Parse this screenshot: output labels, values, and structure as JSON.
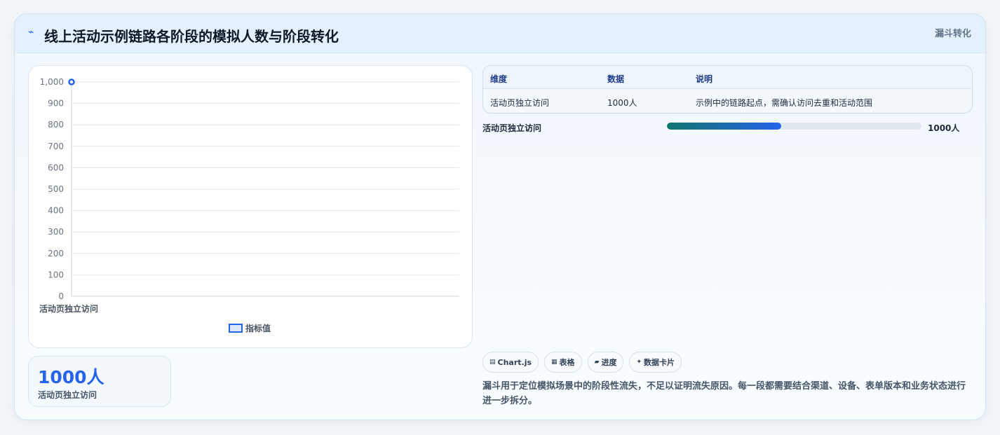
{
  "header": {
    "title": "线上活动示例链路各阶段的模拟人数与阶段转化",
    "tag": "漏斗转化",
    "icon": "trend-line-icon"
  },
  "chart_data": {
    "type": "line",
    "categories": [
      "活动页独立访问"
    ],
    "series": [
      {
        "name": "指标值",
        "values": [
          1000
        ]
      }
    ],
    "y_ticks": [
      "0",
      "100",
      "200",
      "300",
      "400",
      "500",
      "600",
      "700",
      "800",
      "900",
      "1,000"
    ],
    "ylim": [
      0,
      1000
    ],
    "grid": true,
    "legend_position": "bottom",
    "colors": {
      "series": "#2563eb"
    }
  },
  "stat": {
    "value": "1000人",
    "label": "活动页独立访问"
  },
  "table": {
    "headers": [
      "维度",
      "数据",
      "说明"
    ],
    "rows": [
      [
        "活动页独立访问",
        "1000人",
        "示例中的链路起点，需确认访问去重和活动范围"
      ]
    ]
  },
  "progress": {
    "label": "活动页独立访问",
    "value_text": "1000人",
    "fill_fraction": 0.45
  },
  "chips": [
    {
      "icon": "chart-icon",
      "glyph": "▤",
      "label": "Chart.js"
    },
    {
      "icon": "table-icon",
      "glyph": "▦",
      "label": "表格"
    },
    {
      "icon": "progress-icon",
      "glyph": "▰",
      "label": "进度"
    },
    {
      "icon": "card-icon",
      "glyph": "✦",
      "label": "数据卡片"
    }
  ],
  "note": "漏斗用于定位模拟场景中的阶段性流失，不足以证明流失原因。每一段都需要结合渠道、设备、表单版本和业务状态进行进一步拆分。"
}
